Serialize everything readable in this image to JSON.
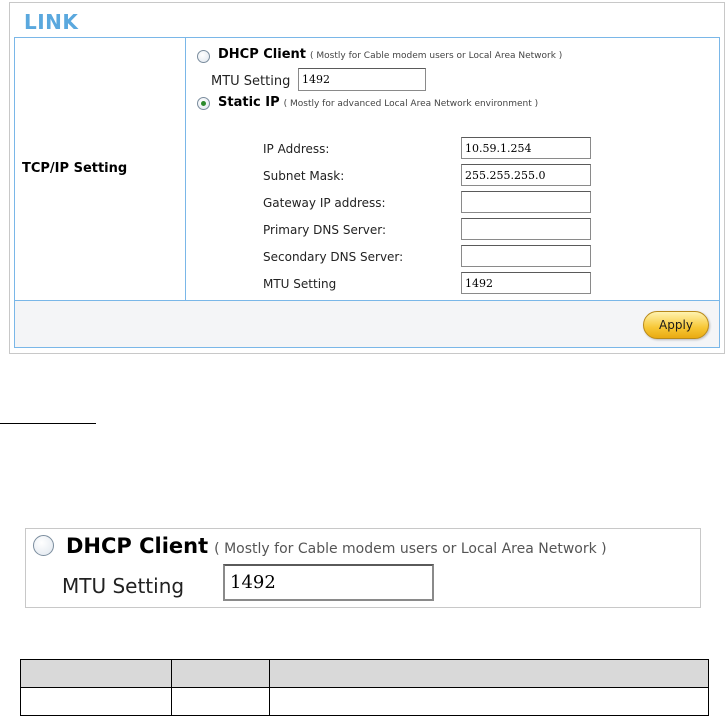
{
  "panel": {
    "title": "LINK",
    "section_label": "TCP/IP Setting",
    "dhcp": {
      "title": "DHCP Client",
      "note": "( Mostly for Cable modem users or Local Area Network )",
      "selected": false,
      "mtu_label": "MTU Setting",
      "mtu_value": "1492"
    },
    "static_ip": {
      "title": "Static IP",
      "note": "( Mostly for advanced Local Area Network environment )",
      "selected": true,
      "fields": [
        {
          "label": "IP Address:",
          "value": "10.59.1.254"
        },
        {
          "label": "Subnet Mask:",
          "value": "255.255.255.0"
        },
        {
          "label": "Gateway IP address:",
          "value": ""
        },
        {
          "label": "Primary DNS Server:",
          "value": ""
        },
        {
          "label": "Secondary DNS Server:",
          "value": ""
        },
        {
          "label": "MTU Setting",
          "value": "1492"
        }
      ]
    },
    "apply_label": "Apply"
  },
  "zoom": {
    "title": "DHCP Client",
    "note": "( Mostly for Cable modem users or Local Area Network )",
    "mtu_label": "MTU Setting",
    "mtu_value": "1492"
  },
  "icons": {
    "radio_unselected": "radio-unselected-icon",
    "radio_selected": "radio-selected-icon"
  },
  "colors": {
    "title_blue": "#5aa8de",
    "border_blue": "#7ab7e8",
    "apply_gold": "#f7c735",
    "radio_dot": "#2c8a2c"
  }
}
